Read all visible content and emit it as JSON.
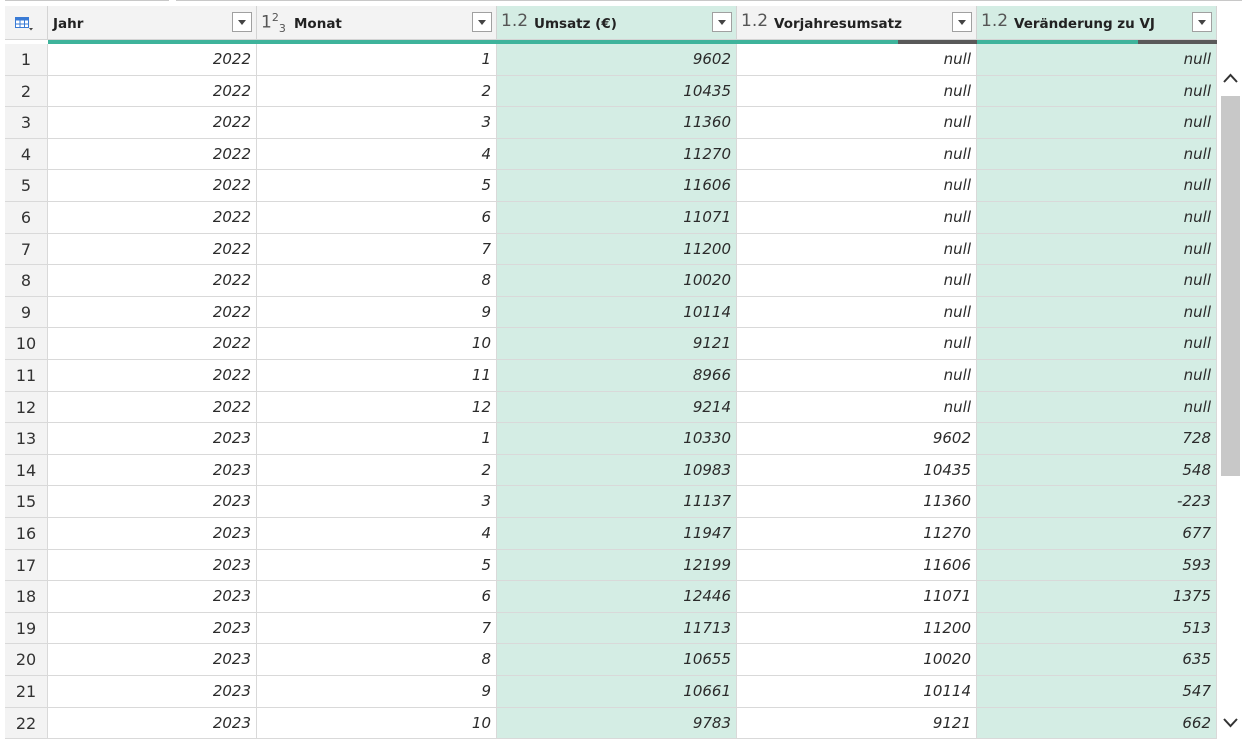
{
  "columns": [
    {
      "type": "",
      "name": "Jahr",
      "selected": false
    },
    {
      "type": "123",
      "name": "Monat",
      "selected": false
    },
    {
      "type": "1.2",
      "name": "Umsatz (€)",
      "selected": true
    },
    {
      "type": "1.2",
      "name": "Vorjahresumsatz",
      "selected": false,
      "quality_error_fraction": 0.33
    },
    {
      "type": "1.2",
      "name": "Veränderung zu VJ",
      "selected": true,
      "quality_error_fraction": 0.33
    }
  ],
  "rows": [
    {
      "idx": "1",
      "jahr": "2022",
      "monat": "1",
      "umsatz": "9602",
      "vorjahr": "null",
      "veraenderung": "null"
    },
    {
      "idx": "2",
      "jahr": "2022",
      "monat": "2",
      "umsatz": "10435",
      "vorjahr": "null",
      "veraenderung": "null"
    },
    {
      "idx": "3",
      "jahr": "2022",
      "monat": "3",
      "umsatz": "11360",
      "vorjahr": "null",
      "veraenderung": "null"
    },
    {
      "idx": "4",
      "jahr": "2022",
      "monat": "4",
      "umsatz": "11270",
      "vorjahr": "null",
      "veraenderung": "null"
    },
    {
      "idx": "5",
      "jahr": "2022",
      "monat": "5",
      "umsatz": "11606",
      "vorjahr": "null",
      "veraenderung": "null"
    },
    {
      "idx": "6",
      "jahr": "2022",
      "monat": "6",
      "umsatz": "11071",
      "vorjahr": "null",
      "veraenderung": "null"
    },
    {
      "idx": "7",
      "jahr": "2022",
      "monat": "7",
      "umsatz": "11200",
      "vorjahr": "null",
      "veraenderung": "null"
    },
    {
      "idx": "8",
      "jahr": "2022",
      "monat": "8",
      "umsatz": "10020",
      "vorjahr": "null",
      "veraenderung": "null"
    },
    {
      "idx": "9",
      "jahr": "2022",
      "monat": "9",
      "umsatz": "10114",
      "vorjahr": "null",
      "veraenderung": "null"
    },
    {
      "idx": "10",
      "jahr": "2022",
      "monat": "10",
      "umsatz": "9121",
      "vorjahr": "null",
      "veraenderung": "null"
    },
    {
      "idx": "11",
      "jahr": "2022",
      "monat": "11",
      "umsatz": "8966",
      "vorjahr": "null",
      "veraenderung": "null"
    },
    {
      "idx": "12",
      "jahr": "2022",
      "monat": "12",
      "umsatz": "9214",
      "vorjahr": "null",
      "veraenderung": "null"
    },
    {
      "idx": "13",
      "jahr": "2023",
      "monat": "1",
      "umsatz": "10330",
      "vorjahr": "9602",
      "veraenderung": "728"
    },
    {
      "idx": "14",
      "jahr": "2023",
      "monat": "2",
      "umsatz": "10983",
      "vorjahr": "10435",
      "veraenderung": "548"
    },
    {
      "idx": "15",
      "jahr": "2023",
      "monat": "3",
      "umsatz": "11137",
      "vorjahr": "11360",
      "veraenderung": "-223"
    },
    {
      "idx": "16",
      "jahr": "2023",
      "monat": "4",
      "umsatz": "11947",
      "vorjahr": "11270",
      "veraenderung": "677"
    },
    {
      "idx": "17",
      "jahr": "2023",
      "monat": "5",
      "umsatz": "12199",
      "vorjahr": "11606",
      "veraenderung": "593"
    },
    {
      "idx": "18",
      "jahr": "2023",
      "monat": "6",
      "umsatz": "12446",
      "vorjahr": "11071",
      "veraenderung": "1375"
    },
    {
      "idx": "19",
      "jahr": "2023",
      "monat": "7",
      "umsatz": "11713",
      "vorjahr": "11200",
      "veraenderung": "513"
    },
    {
      "idx": "20",
      "jahr": "2023",
      "monat": "8",
      "umsatz": "10655",
      "vorjahr": "10020",
      "veraenderung": "635"
    },
    {
      "idx": "21",
      "jahr": "2023",
      "monat": "9",
      "umsatz": "10661",
      "vorjahr": "10114",
      "veraenderung": "547"
    },
    {
      "idx": "22",
      "jahr": "2023",
      "monat": "10",
      "umsatz": "9783",
      "vorjahr": "9121",
      "veraenderung": "662"
    }
  ],
  "colors": {
    "selected_column": "#d4ede4",
    "quality_valid": "#3eb39b",
    "quality_error": "#595959",
    "header": "#f3f3f3"
  },
  "icons": {
    "table_menu": "table-icon",
    "scroll_up": "chevron-up-icon",
    "scroll_down": "chevron-down-icon",
    "column_filter": "dropdown-arrow-icon"
  }
}
